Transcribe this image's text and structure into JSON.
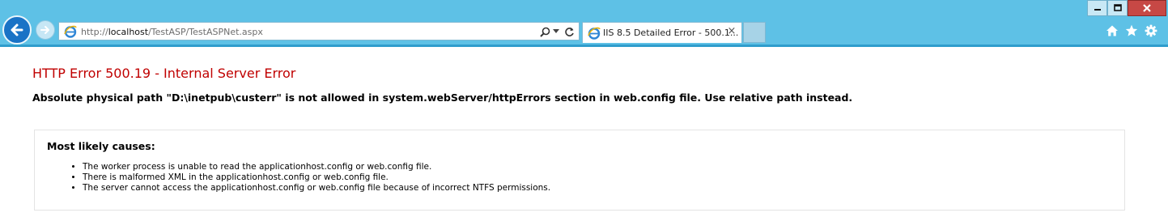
{
  "browser": {
    "address_bar": {
      "url_prefix": "http://",
      "url_host": "localhost",
      "url_path": "/TestASP/TestASPNet.aspx"
    },
    "tabs": [
      {
        "title": "IIS 8.5 Detailed Error - 500.1...",
        "close": "×",
        "active": true
      }
    ],
    "icons": {
      "back": "arrow-left-icon",
      "forward": "arrow-right-icon",
      "page": "ie-page-icon",
      "search": "search-icon",
      "dropdown": "chevron-down-icon",
      "refresh": "refresh-icon",
      "home": "home-icon",
      "favorites": "star-icon",
      "tools": "gear-icon"
    },
    "colors": {
      "chrome": "#5ec1e6",
      "back_button": "#1a73c6",
      "close_button": "#c74845"
    }
  },
  "page": {
    "title": "HTTP Error 500.19 - Internal Server Error",
    "description": "Absolute physical path \"D:\\inetpub\\custerr\" is not allowed in system.webServer/httpErrors section in web.config file. Use relative path instead.",
    "causes": {
      "heading": "Most likely causes:",
      "items": [
        "The worker process is unable to read the applicationhost.config or web.config file.",
        "There is malformed XML in the applicationhost.config or web.config file.",
        "The server cannot access the applicationhost.config or web.config file because of incorrect NTFS permissions."
      ]
    },
    "colors": {
      "title": "#c00000"
    }
  }
}
